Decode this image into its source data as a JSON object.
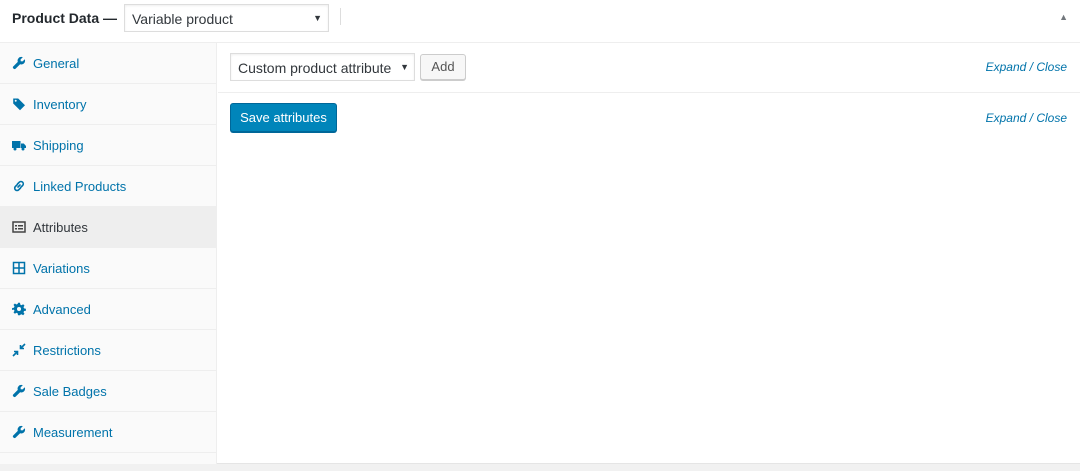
{
  "header": {
    "title": "Product Data —",
    "product_type": {
      "selected": "Variable product"
    }
  },
  "tabs": [
    {
      "label": "General",
      "icon": "wrench-icon"
    },
    {
      "label": "Inventory",
      "icon": "tag-icon"
    },
    {
      "label": "Shipping",
      "icon": "truck-icon"
    },
    {
      "label": "Linked Products",
      "icon": "link-icon"
    },
    {
      "label": "Attributes",
      "icon": "list-icon",
      "active": true
    },
    {
      "label": "Variations",
      "icon": "grid-icon"
    },
    {
      "label": "Advanced",
      "icon": "gear-icon"
    },
    {
      "label": "Restrictions",
      "icon": "shrink-icon"
    },
    {
      "label": "Sale Badges",
      "icon": "wrench-icon"
    },
    {
      "label": "Measurement",
      "icon": "wrench-icon"
    }
  ],
  "attributes": {
    "toolbar": {
      "attribute_select": "Custom product attribute",
      "add_label": "Add",
      "expand_label": "Expand",
      "separator": " / ",
      "close_label": "Close"
    },
    "savebar": {
      "save_label": "Save attributes",
      "expand_label": "Expand",
      "separator": " / ",
      "close_label": "Close"
    }
  },
  "colors": {
    "link": "#0073aa",
    "primary_button": "#0085ba",
    "active_tab_bg": "#eeeeee"
  }
}
